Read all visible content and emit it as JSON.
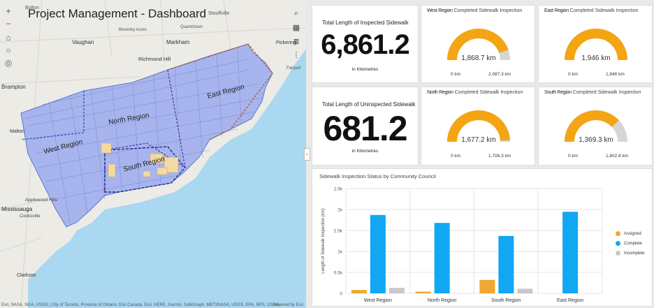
{
  "map": {
    "title": "Project Management - Dashboard",
    "zoom_in": "+",
    "zoom_out": "−",
    "places": [
      "Bolton",
      "Richmond Hill",
      "Markham",
      "Vaughan",
      "Beverley Acres",
      "Quantztown",
      "Stouffville",
      "Pickering",
      "Brampton",
      "Malton",
      "Mississauga",
      "Cooksville",
      "Applewood Hills",
      "Clarkson",
      "Fairport"
    ],
    "region_labels": [
      "North Region",
      "West Region",
      "South Region",
      "East Region"
    ],
    "attribution": "Esri, NASA, NGA, USGS | City of Toronto, Province of Ontario, Esri Canada, Esri, HERE, Garmin, SafeGraph, METI/NASA, USGS, EPA, NPS, USDA,",
    "powered": "Powered by Esri"
  },
  "indicators": [
    {
      "title": "Total Length of Inspected Sidewalk",
      "value": "6,861.2",
      "unit": "in Kilometres"
    },
    {
      "title": "Total Length of Uninspected Sidewalk",
      "value": "681.2",
      "unit": "in Kilometres"
    }
  ],
  "gauges": [
    {
      "region": "West Region",
      "suffix": "Completed Sidewalk Inspection",
      "value_label": "1,868.7 km",
      "min": "0 km",
      "max": "2,087.3 km",
      "fraction": 0.895
    },
    {
      "region": "East Region",
      "suffix": "Completed Sidewalk Inspection",
      "value_label": "1,946 km",
      "min": "0 km",
      "max": "1,946 km",
      "fraction": 1.0
    },
    {
      "region": "North Region",
      "suffix": "Completed Sidewalk Inspection",
      "value_label": "1,677.2 km",
      "min": "0 km",
      "max": "1,706.3 km",
      "fraction": 0.983
    },
    {
      "region": "South Region",
      "suffix": "Completed Sidewalk Inspection",
      "value_label": "1,369.3 km",
      "min": "0 km",
      "max": "1,802.8 km",
      "fraction": 0.76
    }
  ],
  "colors": {
    "complete": "#12a7f2",
    "assigned": "#f0a830",
    "incomplete": "#c8c8c8",
    "gauge_fill": "#f4a514",
    "gauge_track": "#d6d6d6",
    "region_fill": "#a7b4ee"
  },
  "chart_data": {
    "type": "bar",
    "title": "Sidewalk Inspection Status by Community Council",
    "ylabel": "Length of Sidewalk Inspection (km)",
    "categories": [
      "West Region",
      "North Region",
      "South Region",
      "East Region"
    ],
    "ylim": [
      0,
      2500
    ],
    "yticks": [
      "0",
      "0.5k",
      "1k",
      "1.5k",
      "2k",
      "2.5k"
    ],
    "series": [
      {
        "name": "Assigned",
        "color": "#f0a830",
        "values": [
          80,
          40,
          320,
          0
        ]
      },
      {
        "name": "Complete",
        "color": "#12a7f2",
        "values": [
          1870,
          1680,
          1370,
          1946
        ]
      },
      {
        "name": "Incomplete",
        "color": "#c8c8c8",
        "values": [
          130,
          0,
          110,
          0
        ]
      }
    ],
    "legend_position": "right"
  }
}
